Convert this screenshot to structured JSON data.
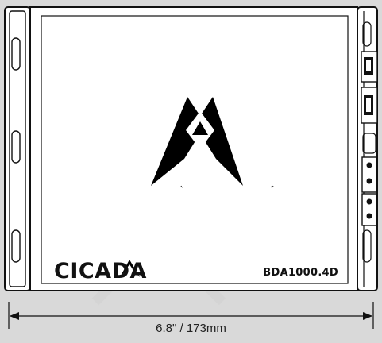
{
  "brand": "CICADA",
  "model": "BDA1000.4D",
  "dimension": "6.8\" / 173mm",
  "colors": {
    "background": "#d9d9d9",
    "body": "#ffffff",
    "outline": "#111111",
    "logo": "#000000"
  },
  "icons": [
    "logo-icon",
    "dimension-arrow-icon"
  ]
}
